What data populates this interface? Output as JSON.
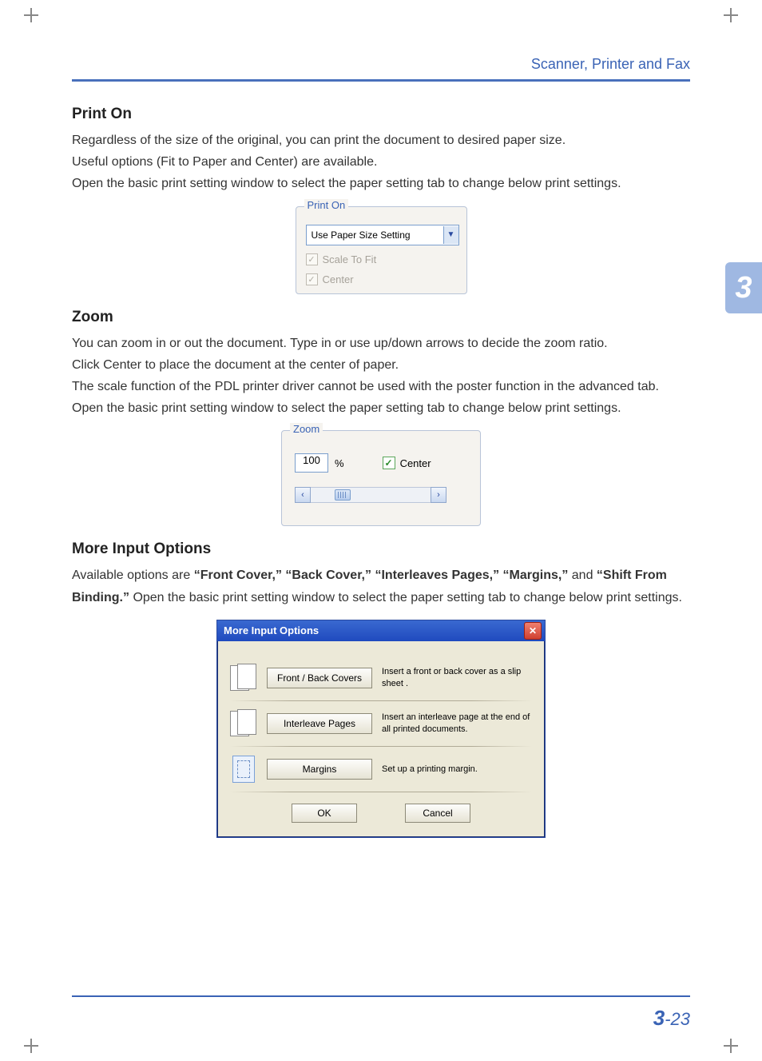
{
  "header": {
    "chapter_title": "Scanner, Printer and Fax",
    "chapter_number": "3"
  },
  "footer": {
    "page_label_big": "3",
    "page_label_small": "-23"
  },
  "sections": {
    "print_on": {
      "title": "Print On",
      "p1": "Regardless of the size of the original, you can print the document to desired paper size.",
      "p2": "Useful options (Fit to Paper and Center) are available.",
      "p3": "Open the basic print setting window to select the paper setting tab to change below print settings.",
      "figure": {
        "legend": "Print On",
        "combo_value": "Use Paper Size Setting",
        "check1": "Scale To Fit",
        "check2": "Center"
      }
    },
    "zoom": {
      "title": "Zoom",
      "p1": "You can zoom in or out the document. Type in or use up/down arrows to decide the zoom ratio.",
      "p2": "Click Center to place the document at the center of paper.",
      "p3": "The scale function of the PDL printer driver cannot be used with the poster function in the advanced tab.",
      "p4": "Open the basic print setting window to select the paper setting tab to change below print settings.",
      "figure": {
        "legend": "Zoom",
        "value": "100",
        "pct": "%",
        "center_label": "Center"
      }
    },
    "more": {
      "title": "More Input Options",
      "p1_a": "Available options are ",
      "p1_b": "“Front Cover,” “Back Cover,” “Interleaves Pages,” “Margins,”",
      "p1_c": " and ",
      "p1_d": "“Shift From Binding.”",
      "p1_e": " Open the basic print setting window to select the paper setting tab to change below print settings.",
      "dialog": {
        "title": "More Input Options",
        "rows": [
          {
            "button": "Front / Back Covers",
            "desc": "Insert a front or back cover as a slip sheet ."
          },
          {
            "button": "Interleave Pages",
            "desc": "Insert an interleave page at the end of all printed documents."
          },
          {
            "button": "Margins",
            "desc": "Set up a printing margin."
          }
        ],
        "ok": "OK",
        "cancel": "Cancel"
      }
    }
  }
}
